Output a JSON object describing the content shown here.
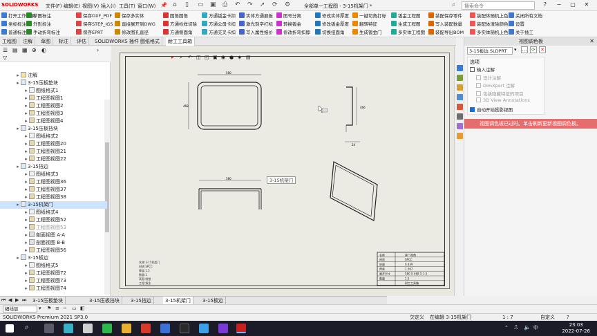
{
  "app": {
    "logo": "SOLIDWORKS",
    "menus": [
      "文件(F)",
      "编辑(E)",
      "视图(V)",
      "插入(I)",
      "工具(T)",
      "窗口(W)"
    ],
    "doc_title": "全部单一工程图 - 3-15机架门 *",
    "search_placeholder": "搜索命令"
  },
  "commands": {
    "col1": [
      "打开工作目录",
      "坐标标注",
      "普通标注"
    ],
    "col2": [
      "草图标注",
      "外形标注",
      "手动折弯标注"
    ],
    "col3": [
      "保存DXF_PDF",
      "保存STEP_IGS",
      "保存EPRT"
    ],
    "col4": [
      "保存多实体",
      "直接展开到DWG",
      "修改图孔直径"
    ],
    "col5": [
      "圆角圆角",
      "方通检样切除",
      "方通侧面角"
    ],
    "col6": [
      "方通钣金卡扣",
      "方通公母卡扣",
      "方通交叉卡扣"
    ],
    "col7": [
      "实体方通展板",
      "激光刻字打标",
      "写入属性报价"
    ],
    "col8": [
      "图号分离",
      "转换钣金",
      "修改折弯扣脖"
    ],
    "col9": [
      "修改实体厚度",
      "修改钣金厚度",
      "切换扭面角"
    ],
    "col10": [
      "一键切角打标",
      "翻转特征",
      "生成钣金门"
    ],
    "col11": [
      "钣金工程图",
      "生成工程图",
      "多实体工程图"
    ],
    "col12": [
      "装配保存零件",
      "写入装配数量",
      "装配导出BOM"
    ],
    "col13": [
      "装配体随机上色",
      "装配体清除颜色",
      "多实体随机上色"
    ],
    "col14": [
      "关闭所有文档",
      "设置",
      "关于插工"
    ]
  },
  "cmd_tabs": [
    "工程图",
    "注解",
    "草图",
    "标注",
    "评估",
    "SOLIDWORKS 插件",
    "图纸格式",
    "耐工工具箱"
  ],
  "tree": [
    {
      "label": "注解",
      "indent": 1,
      "icon": "annotation-icon"
    },
    {
      "label": "3-15压板垫块",
      "indent": 1,
      "icon": "sheet-icon"
    },
    {
      "label": "图纸格式1",
      "indent": 2,
      "icon": "format-icon"
    },
    {
      "label": "工程图视图1",
      "indent": 2,
      "icon": "view-icon"
    },
    {
      "label": "工程图视图2",
      "indent": 2,
      "icon": "view-icon"
    },
    {
      "label": "工程图视图3",
      "indent": 2,
      "icon": "view-icon"
    },
    {
      "label": "工程图视图4",
      "indent": 2,
      "icon": "view-icon"
    },
    {
      "label": "3-15压板挡块",
      "indent": 1,
      "icon": "sheet-icon"
    },
    {
      "label": "图纸格式2",
      "indent": 2,
      "icon": "format-icon"
    },
    {
      "label": "工程图视图20",
      "indent": 2,
      "icon": "view-icon"
    },
    {
      "label": "工程图视图21",
      "indent": 2,
      "icon": "view-icon"
    },
    {
      "label": "工程图视图22",
      "indent": 2,
      "icon": "view-icon"
    },
    {
      "label": "3-15挡边",
      "indent": 1,
      "icon": "sheet-icon"
    },
    {
      "label": "图纸格式3",
      "indent": 2,
      "icon": "format-icon"
    },
    {
      "label": "工程图视图36",
      "indent": 2,
      "icon": "view-icon"
    },
    {
      "label": "工程图视图37",
      "indent": 2,
      "icon": "view-icon"
    },
    {
      "label": "工程图视图38",
      "indent": 2,
      "icon": "view-icon"
    },
    {
      "label": "3-15机架门",
      "indent": 1,
      "icon": "sheet-icon",
      "selected": true
    },
    {
      "label": "图纸格式4",
      "indent": 2,
      "icon": "format-icon"
    },
    {
      "label": "工程图视图52",
      "indent": 2,
      "icon": "view-icon"
    },
    {
      "label": "工程图视图53",
      "indent": 2,
      "icon": "view-icon",
      "dim": true
    },
    {
      "label": "剖面视图 A-A",
      "indent": 2,
      "icon": "section-icon"
    },
    {
      "label": "剖面视图 B-B",
      "indent": 2,
      "icon": "section-icon"
    },
    {
      "label": "工程图视图56",
      "indent": 2,
      "icon": "view-icon"
    },
    {
      "label": "3-15板边",
      "indent": 1,
      "icon": "sheet-icon"
    },
    {
      "label": "图纸格式5",
      "indent": 2,
      "icon": "format-icon"
    },
    {
      "label": "工程图视图72",
      "indent": 2,
      "icon": "view-icon"
    },
    {
      "label": "工程图视图73",
      "indent": 2,
      "icon": "view-icon"
    },
    {
      "label": "工程图视图74",
      "indent": 2,
      "icon": "view-icon"
    }
  ],
  "drawing": {
    "tooltip": "3-15机架门",
    "dim_top": "580",
    "dim_left": "468",
    "dim_bottom": "580",
    "dim_side": "24",
    "notes": [
      "名称:3-15机架门",
      "材质:SPCC",
      "厚度:1.5",
      "数量:1",
      "表面:喷塑",
      "工程:钣金"
    ],
    "title_block": [
      [
        "名称",
        "第一视角"
      ],
      [
        "材质",
        "SPCC"
      ],
      [
        "质量",
        "0.439"
      ],
      [
        "厚度",
        "1.567"
      ],
      [
        "展开尺寸",
        "580 X 468 X 1.5"
      ],
      [
        "数量",
        "1.5"
      ],
      [
        "",
        "耐工工具箱"
      ]
    ]
  },
  "taskpane": {
    "title": "视图调色板",
    "file_select": "3-15板边.SLDPRT",
    "options_label": "选项",
    "options": [
      {
        "label": "输入注解",
        "checked": false,
        "enabled": true
      },
      {
        "label": "设计注解",
        "checked": false,
        "enabled": false
      },
      {
        "label": "DimXpert 注解",
        "checked": false,
        "enabled": false
      },
      {
        "label": "包括隐藏特征的项目",
        "checked": false,
        "enabled": false
      },
      {
        "label": "3D View Annotations",
        "checked": false,
        "enabled": false
      },
      {
        "label": "自动开始投影视图",
        "checked": true,
        "enabled": true
      }
    ],
    "banner": "视图调色板已过时。单击刷新更新视图调色板。"
  },
  "sheet_tabs": [
    "3-15压板垫块",
    "3-15压板挡块",
    "3-15挡边",
    "3-15机架门",
    "3-15板边"
  ],
  "active_sheet": "3-15机架门",
  "viewbar": {
    "layer": "细线层"
  },
  "status": {
    "version": "SOLIDWORKS Premium 2021 SP3.0",
    "state": "欠定义",
    "editing": "在编辑 3-15机架门",
    "scale": "1 : 7",
    "unit": "自定义"
  },
  "taskbar": {
    "time": "23:03",
    "date": "2022-07-26"
  },
  "colors": {
    "accent": "#1a6ed8",
    "banner": "#e56d6d",
    "sheet_bg": "#ecebe3",
    "taskbar_bg": "#1c1c28"
  }
}
